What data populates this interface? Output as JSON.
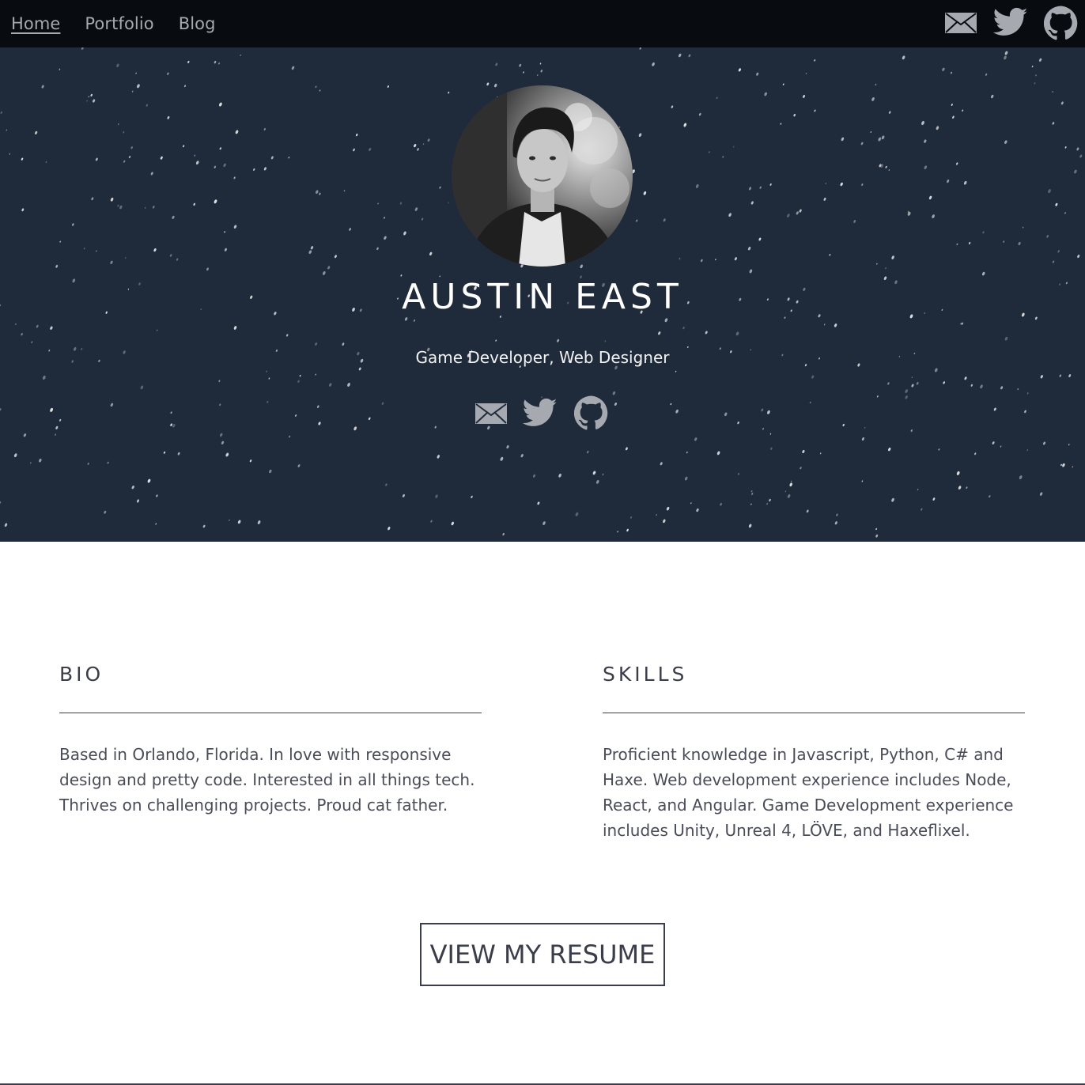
{
  "nav": {
    "links": [
      {
        "label": "Home",
        "active": true
      },
      {
        "label": "Portfolio",
        "active": false
      },
      {
        "label": "Blog",
        "active": false
      }
    ],
    "icons": [
      "mail-icon",
      "twitter-icon",
      "github-icon"
    ]
  },
  "hero": {
    "name": "AUSTIN EAST",
    "tagline": "Game Developer, Web Designer",
    "icons": [
      "mail-icon",
      "twitter-icon",
      "github-icon"
    ]
  },
  "bio": {
    "heading": "BIO",
    "text": "Based in Orlando, Florida. In love with responsive design and pretty code. Interested in all things tech. Thrives on challenging projects. Proud cat father."
  },
  "skills": {
    "heading": "SKILLS",
    "text": "Proficient knowledge in Javascript, Python, C# and Haxe. Web development experience includes Node, React, and Angular. Game Development experience includes Unity, Unreal 4, LÖVE, and Haxeflixel."
  },
  "resume_button": {
    "label": "VIEW MY RESUME"
  },
  "colors": {
    "nav_bg": "#080b10",
    "hero_bg": "#1f2a3b",
    "text_dark": "#3b3d4a",
    "icon_gray": "#a6aab0"
  }
}
